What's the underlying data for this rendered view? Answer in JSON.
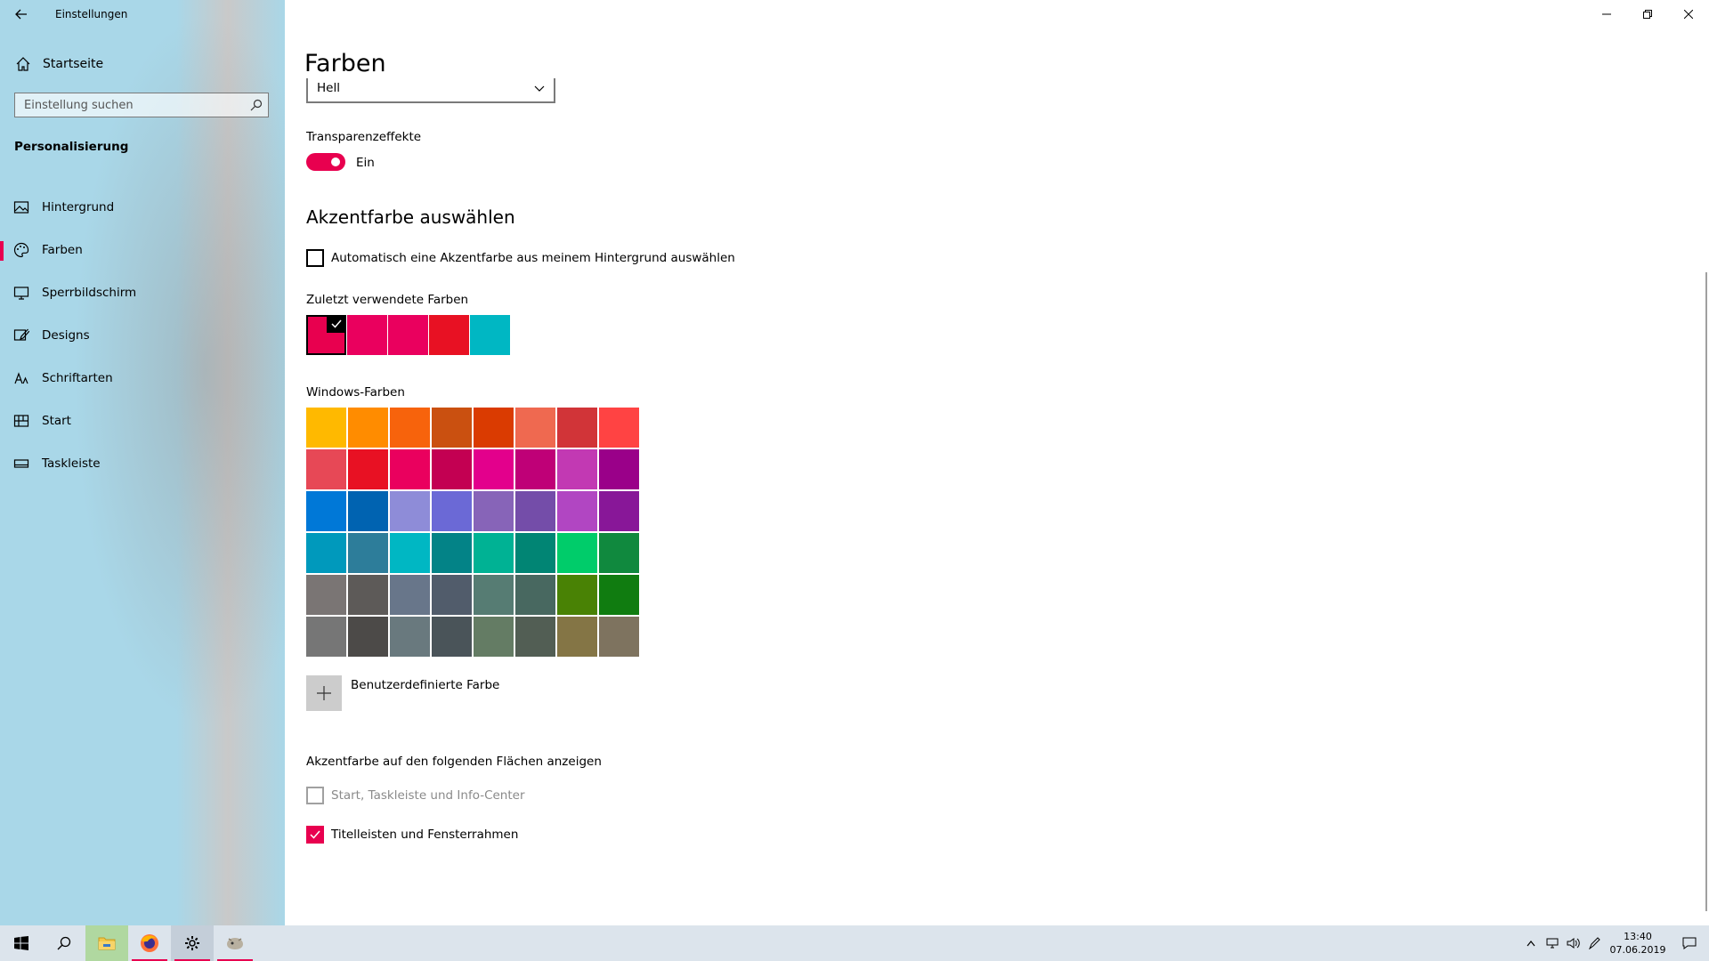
{
  "window": {
    "title": "Einstellungen",
    "back_icon": "arrow-left-icon",
    "controls": {
      "minimize": "–",
      "restore": "❐",
      "close": "✕"
    }
  },
  "sidebar": {
    "home_label": "Startseite",
    "search_placeholder": "Einstellung suchen",
    "section": "Personalisierung",
    "items": [
      {
        "label": "Hintergrund",
        "icon": "image-icon"
      },
      {
        "label": "Farben",
        "icon": "palette-icon",
        "active": true
      },
      {
        "label": "Sperrbildschirm",
        "icon": "monitor-icon"
      },
      {
        "label": "Designs",
        "icon": "brush-icon"
      },
      {
        "label": "Schriftarten",
        "icon": "font-icon"
      },
      {
        "label": "Start",
        "icon": "start-layout-icon"
      },
      {
        "label": "Taskleiste",
        "icon": "taskbar-icon"
      }
    ]
  },
  "main": {
    "title": "Farben",
    "mode_dropdown_value": "Hell",
    "transparency_label": "Transparenzeffekte",
    "transparency_state": "Ein",
    "accent_title": "Akzentfarbe auswählen",
    "auto_accent_label": "Automatisch eine Akzentfarbe aus meinem Hintergrund auswählen",
    "recent_label": "Zuletzt verwendete Farben",
    "recent_colors": [
      "#e8004f",
      "#ea005e",
      "#ea005e",
      "#e81123",
      "#00b7c3"
    ],
    "windows_colors_label": "Windows-Farben",
    "windows_colors": [
      [
        "#ffb900",
        "#ff8c00",
        "#f7630c",
        "#ca5010",
        "#da3b01",
        "#ef6950",
        "#d13438",
        "#ff4343"
      ],
      [
        "#e74856",
        "#e81123",
        "#ea005e",
        "#c30052",
        "#e3008c",
        "#bf0077",
        "#c239b3",
        "#9a0089"
      ],
      [
        "#0078d7",
        "#0063b1",
        "#8e8cd8",
        "#6b69d6",
        "#8764b8",
        "#744da9",
        "#b146c2",
        "#881798"
      ],
      [
        "#0099bc",
        "#2d7d9a",
        "#00b7c3",
        "#038387",
        "#00b294",
        "#018574",
        "#00cc6a",
        "#10893e"
      ],
      [
        "#7a7574",
        "#5d5a58",
        "#68768a",
        "#515c6b",
        "#567c73",
        "#486860",
        "#498205",
        "#107c10"
      ],
      [
        "#767676",
        "#4c4a48",
        "#69797e",
        "#4a5459",
        "#647c64",
        "#525e54",
        "#847545",
        "#7e735f"
      ]
    ],
    "custom_color_label": "Benutzerdefinierte Farbe",
    "surfaces_label": "Akzentfarbe auf den folgenden Flächen anzeigen",
    "surface_start_label": "Start, Taskleiste und Info-Center",
    "surface_titlebar_label": "Titelleisten und Fensterrahmen"
  },
  "taskbar": {
    "time": "13:40",
    "date": "07.06.2019"
  },
  "colors": {
    "accent": "#e8004f",
    "sidebar_bg": "#a9d7e8",
    "taskbar_bg": "#dce4ec"
  }
}
